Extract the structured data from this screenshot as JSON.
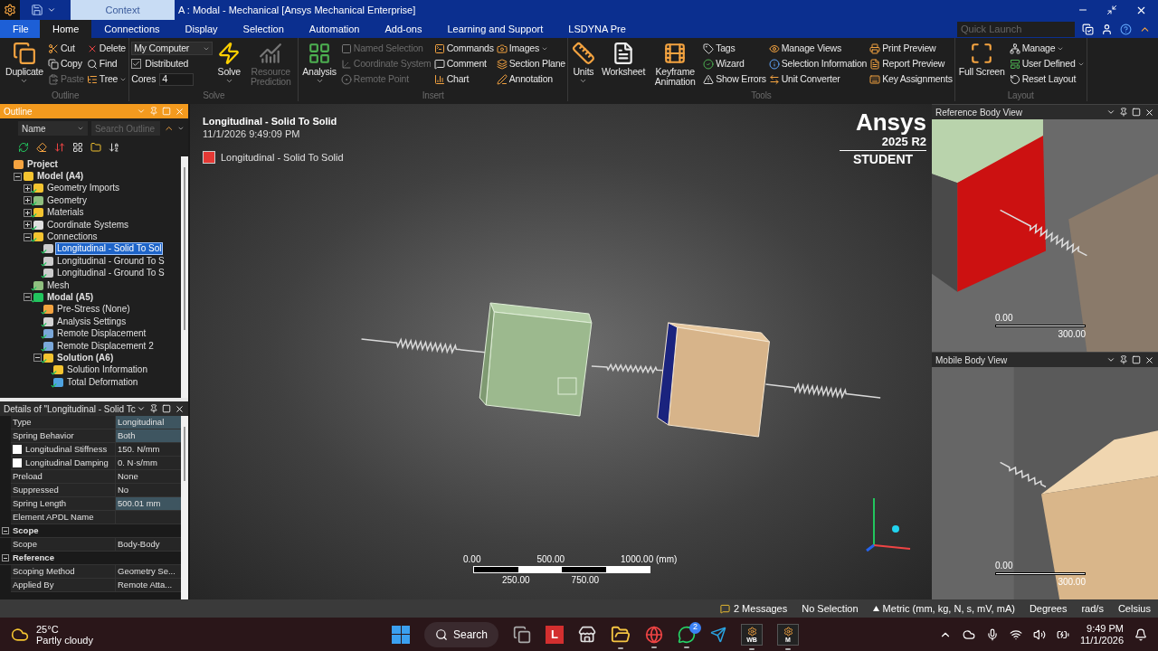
{
  "window": {
    "context_tab": "Context",
    "title": "A : Modal - Mechanical [Ansys Mechanical Enterprise]"
  },
  "tabs": [
    {
      "label": "File",
      "kind": "file",
      "selected": false
    },
    {
      "label": "Home",
      "kind": "tab",
      "selected": true
    },
    {
      "label": "Connections",
      "kind": "tab",
      "selected": false
    },
    {
      "label": "Display",
      "kind": "tab",
      "selected": false
    },
    {
      "label": "Selection",
      "kind": "tab",
      "selected": false
    },
    {
      "label": "Automation",
      "kind": "tab",
      "selected": false
    },
    {
      "label": "Add-ons",
      "kind": "tab",
      "selected": false
    },
    {
      "label": "Learning and Support",
      "kind": "tab",
      "selected": false
    },
    {
      "label": "LSDYNA Pre",
      "kind": "tab",
      "selected": false
    }
  ],
  "quick_launch": {
    "placeholder": "Quick Launch"
  },
  "ribbon": [
    {
      "label": "Outline",
      "columns": [
        {
          "kind": "large",
          "label": "Duplicate",
          "dropdown": true,
          "disabled": false
        },
        {
          "kind": "small",
          "items": [
            {
              "label": "Cut",
              "dropdown": false,
              "disabled": false
            },
            {
              "label": "Copy",
              "dropdown": false,
              "disabled": false
            },
            {
              "label": "Paste",
              "dropdown": false,
              "disabled": true
            }
          ]
        },
        {
          "kind": "small",
          "items": [
            {
              "label": "Delete",
              "dropdown": false,
              "disabled": false
            },
            {
              "label": "Find",
              "dropdown": false,
              "disabled": false
            },
            {
              "label": "Tree",
              "dropdown": true,
              "disabled": false
            }
          ]
        }
      ]
    },
    {
      "label": "Solve",
      "columns": [
        {
          "kind": "settings",
          "target": "My Computer",
          "distributed": {
            "label": "Distributed",
            "checked": true
          },
          "cores": {
            "label": "Cores",
            "value": "4"
          }
        },
        {
          "kind": "large",
          "label": "Solve",
          "dropdown": true,
          "disabled": false
        },
        {
          "kind": "large",
          "label": "Resource Prediction",
          "dropdown": false,
          "disabled": true
        }
      ]
    },
    {
      "label": "Insert",
      "columns": [
        {
          "kind": "large",
          "label": "Analysis",
          "dropdown": true,
          "disabled": false
        },
        {
          "kind": "small",
          "items": [
            {
              "label": "Named Selection",
              "dropdown": false,
              "disabled": true
            },
            {
              "label": "Coordinate System",
              "dropdown": false,
              "disabled": true
            },
            {
              "label": "Remote Point",
              "dropdown": false,
              "disabled": true
            }
          ]
        },
        {
          "kind": "small",
          "items": [
            {
              "label": "Commands",
              "dropdown": false,
              "disabled": false
            },
            {
              "label": "Comment",
              "dropdown": false,
              "disabled": false
            },
            {
              "label": "Chart",
              "dropdown": false,
              "disabled": false
            }
          ]
        },
        {
          "kind": "small",
          "items": [
            {
              "label": "Images",
              "dropdown": true,
              "disabled": false
            },
            {
              "label": "Section Plane",
              "dropdown": false,
              "disabled": false
            },
            {
              "label": "Annotation",
              "dropdown": false,
              "disabled": false
            }
          ]
        }
      ]
    },
    {
      "label": "Tools",
      "columns": [
        {
          "kind": "large",
          "label": "Units",
          "dropdown": true,
          "disabled": false
        },
        {
          "kind": "large",
          "label": "Worksheet",
          "dropdown": false,
          "disabled": false
        },
        {
          "kind": "large",
          "label": "Keyframe Animation",
          "dropdown": false,
          "disabled": false
        },
        {
          "kind": "small",
          "items": [
            {
              "label": "Tags",
              "dropdown": false,
              "disabled": false
            },
            {
              "label": "Wizard",
              "dropdown": false,
              "disabled": false
            },
            {
              "label": "Show Errors",
              "dropdown": false,
              "disabled": false
            }
          ]
        },
        {
          "kind": "small",
          "items": [
            {
              "label": "Manage Views",
              "dropdown": false,
              "disabled": false
            },
            {
              "label": "Selection Information",
              "dropdown": false,
              "disabled": false
            },
            {
              "label": "Unit Converter",
              "dropdown": false,
              "disabled": false
            }
          ]
        },
        {
          "kind": "small",
          "items": [
            {
              "label": "Print Preview",
              "dropdown": false,
              "disabled": false
            },
            {
              "label": "Report Preview",
              "dropdown": false,
              "disabled": false
            },
            {
              "label": "Key Assignments",
              "dropdown": false,
              "disabled": false
            }
          ]
        }
      ]
    },
    {
      "label": "Layout",
      "columns": [
        {
          "kind": "large",
          "label": "Full Screen",
          "dropdown": false,
          "disabled": false
        },
        {
          "kind": "small",
          "items": [
            {
              "label": "Manage",
              "dropdown": true,
              "disabled": false
            },
            {
              "label": "User Defined",
              "dropdown": true,
              "disabled": false
            },
            {
              "label": "Reset Layout",
              "dropdown": false,
              "disabled": false
            }
          ]
        }
      ]
    }
  ],
  "outline": {
    "title": "Outline",
    "column": "Name",
    "search": {
      "placeholder": "Search Outline"
    },
    "tree": [
      {
        "label": "Project",
        "kind": "project",
        "bold": true,
        "ok": false,
        "selected": false,
        "children": [
          {
            "label": "Model (A4)",
            "kind": "model",
            "bold": true,
            "ok": false,
            "selected": false,
            "expanded": true,
            "children": [
              {
                "label": "Geometry Imports",
                "kind": "folder",
                "bold": false,
                "ok": true,
                "selected": false,
                "expanded": false
              },
              {
                "label": "Geometry",
                "kind": "geometry",
                "bold": false,
                "ok": true,
                "selected": false,
                "expanded": false
              },
              {
                "label": "Materials",
                "kind": "folder",
                "bold": false,
                "ok": true,
                "selected": false,
                "expanded": false
              },
              {
                "label": "Coordinate Systems",
                "kind": "coords",
                "bold": false,
                "ok": true,
                "selected": false,
                "expanded": false
              },
              {
                "label": "Connections",
                "kind": "folder",
                "bold": false,
                "ok": true,
                "selected": false,
                "expanded": true,
                "children": [
                  {
                    "label": "Longitudinal - Solid To Sol",
                    "kind": "spring",
                    "bold": false,
                    "ok": true,
                    "selected": true
                  },
                  {
                    "label": "Longitudinal - Ground To S",
                    "kind": "spring",
                    "bold": false,
                    "ok": true,
                    "selected": false
                  },
                  {
                    "label": "Longitudinal - Ground To S",
                    "kind": "spring",
                    "bold": false,
                    "ok": true,
                    "selected": false
                  }
                ]
              },
              {
                "label": "Mesh",
                "kind": "geometry",
                "bold": false,
                "ok": true,
                "selected": false
              },
              {
                "label": "Modal (A5)",
                "kind": "analysis",
                "bold": true,
                "ok": true,
                "selected": false,
                "expanded": true,
                "children": [
                  {
                    "label": "Pre-Stress (None)",
                    "kind": "prestress",
                    "bold": false,
                    "ok": true,
                    "selected": false
                  },
                  {
                    "label": "Analysis Settings",
                    "kind": "settings",
                    "bold": false,
                    "ok": true,
                    "selected": false
                  },
                  {
                    "label": "Remote Displacement",
                    "kind": "support",
                    "bold": false,
                    "ok": true,
                    "selected": false
                  },
                  {
                    "label": "Remote Displacement 2",
                    "kind": "support",
                    "bold": false,
                    "ok": true,
                    "selected": false
                  },
                  {
                    "label": "Solution (A6)",
                    "kind": "folder",
                    "bold": true,
                    "ok": true,
                    "selected": false,
                    "expanded": true,
                    "children": [
                      {
                        "label": "Solution Information",
                        "kind": "info",
                        "bold": false,
                        "ok": true,
                        "selected": false
                      },
                      {
                        "label": "Total Deformation",
                        "kind": "result",
                        "bold": false,
                        "ok": true,
                        "selected": false
                      }
                    ]
                  }
                ]
              }
            ]
          }
        ]
      }
    ]
  },
  "details": {
    "title": "Details of \"Longitudinal - Solid Tc",
    "rows": [
      {
        "kind": "row",
        "name": "Type",
        "value": "Longitudinal",
        "highlighted": true
      },
      {
        "kind": "row",
        "name": "Spring Behavior",
        "value": "Both",
        "highlighted": true
      },
      {
        "kind": "check",
        "name": "Longitudinal Stiffness",
        "value": "150. N/mm",
        "highlighted": false,
        "checked": false
      },
      {
        "kind": "check",
        "name": "Longitudinal Damping",
        "value": "0. N·s/mm",
        "highlighted": false,
        "checked": false
      },
      {
        "kind": "row",
        "name": "Preload",
        "value": "None",
        "highlighted": false
      },
      {
        "kind": "row",
        "name": "Suppressed",
        "value": "No",
        "highlighted": false
      },
      {
        "kind": "row",
        "name": "Spring Length",
        "value": "500.01 mm",
        "highlighted": true
      },
      {
        "kind": "row",
        "name": "Element APDL Name",
        "value": "",
        "highlighted": false
      },
      {
        "kind": "category",
        "name": "Scope",
        "expanded": true
      },
      {
        "kind": "row",
        "name": "Scope",
        "value": "Body-Body",
        "highlighted": false
      },
      {
        "kind": "category",
        "name": "Reference",
        "expanded": true
      },
      {
        "kind": "row",
        "name": "Scoping Method",
        "value": "Geometry Se...",
        "highlighted": false
      },
      {
        "kind": "row",
        "name": "Applied By",
        "value": "Remote Atta...",
        "highlighted": false
      }
    ]
  },
  "viewport": {
    "title": "Longitudinal - Solid To Solid",
    "timestamp": "11/1/2026 9:49:09 PM",
    "legend": [
      {
        "label": "Longitudinal - Solid To Solid",
        "color": "#e53935"
      }
    ],
    "logo": {
      "name": "Ansys",
      "version": "2025 R2",
      "edition": "STUDENT"
    },
    "scale": {
      "top_labels": [
        "0.00",
        "500.00",
        "1000.00 (mm)"
      ],
      "bottom_labels": [
        "250.00",
        "750.00"
      ]
    }
  },
  "side_views": [
    {
      "title": "Reference Body View",
      "kind": "reference",
      "scale": [
        "0.00",
        "300.00"
      ]
    },
    {
      "title": "Mobile Body View",
      "kind": "mobile",
      "scale": [
        "0.00",
        "300.00"
      ]
    }
  ],
  "status_bar": {
    "messages": "2 Messages",
    "selection": "No Selection",
    "units": "Metric (mm, kg, N, s, mV, mA)",
    "angle": "Degrees",
    "rotation": "rad/s",
    "temperature": "Celsius"
  },
  "taskbar": {
    "weather": {
      "temp": "25°C",
      "condition": "Partly cloudy"
    },
    "apps": [
      {
        "kind": "windows",
        "running": false
      },
      {
        "kind": "search",
        "label": "Search",
        "running": false
      },
      {
        "kind": "taskview",
        "running": false
      },
      {
        "kind": "letter",
        "label": "L",
        "running": false
      },
      {
        "kind": "store",
        "running": false
      },
      {
        "kind": "folder",
        "running": true
      },
      {
        "kind": "browser",
        "running": true
      },
      {
        "kind": "chat",
        "badge": "2",
        "running": true
      },
      {
        "kind": "send",
        "running": false
      },
      {
        "kind": "workbench",
        "label": "WB",
        "running": true
      },
      {
        "kind": "mechanical",
        "label": "M",
        "running": true
      }
    ],
    "time": "9:49 PM",
    "date": "11/1/2026"
  }
}
